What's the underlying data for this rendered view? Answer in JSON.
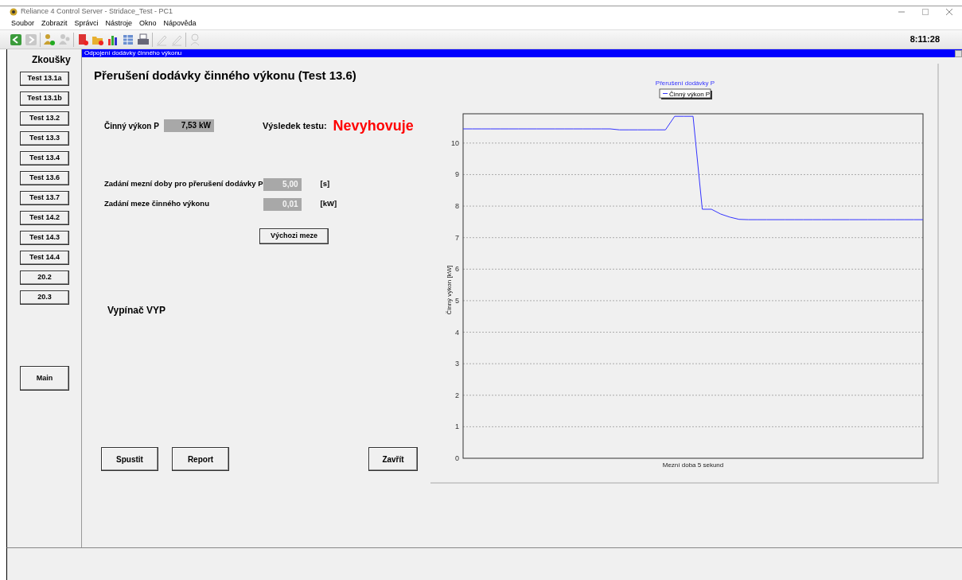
{
  "window": {
    "title": "Reliance 4 Control Server - Stridace_Test - PC1"
  },
  "menu": [
    {
      "label": "Soubor"
    },
    {
      "label": "Zobrazit"
    },
    {
      "label": "Správci"
    },
    {
      "label": "Nástroje"
    },
    {
      "label": "Okno"
    },
    {
      "label": "Nápověda"
    }
  ],
  "toolbar": {
    "buttons": [
      {
        "kind": "back",
        "disabled": false
      },
      {
        "kind": "forward",
        "disabled": true
      },
      {
        "kind": "user-add",
        "disabled": false
      },
      {
        "kind": "user",
        "disabled": true
      },
      {
        "kind": "document",
        "disabled": false
      },
      {
        "kind": "folder",
        "disabled": false
      },
      {
        "kind": "bar-chart",
        "disabled": false
      },
      {
        "kind": "table",
        "disabled": false
      },
      {
        "kind": "printer",
        "disabled": false
      },
      {
        "kind": "pen",
        "disabled": true
      },
      {
        "kind": "pen",
        "disabled": true
      },
      {
        "kind": "person",
        "disabled": true
      }
    ],
    "clock": "8:11:28"
  },
  "sidebar": {
    "heading": "Zkoušky",
    "buttons": [
      "Test 13.1a",
      "Test 13.1b",
      "Test 13.2",
      "Test 13.3",
      "Test 13.4",
      "Test 13.6",
      "Test 13.7",
      "Test 14.2",
      "Test 14.3",
      "Test 14.4",
      "20.2",
      "20.3"
    ],
    "main_button": "Main"
  },
  "dialog": {
    "title": "Odpojení dodávky činného výkonu",
    "heading": "Přerušení dodávky činného výkonu (Test 13.6)",
    "power": {
      "label": "Činný výkon P",
      "value": "7,53 kW"
    },
    "result": {
      "label": "Výsledek testu:",
      "value": "Nevyhovuje",
      "passed": false
    },
    "limits": [
      {
        "label": "Zadání mezní doby pro přerušení dodávky P",
        "value": "5,00",
        "unit": "[s]"
      },
      {
        "label": "Zadání meze činného výkonu",
        "value": "0,01",
        "unit": "[kW]"
      }
    ],
    "default_button": "Výchozi meze",
    "breaker_status": "Vypínač VYP",
    "buttons": [
      "Spustit",
      "Report"
    ],
    "close_button": "Zavřít",
    "chart": {
      "chart_data": {
        "type": "line",
        "title": "Přerušení dodávky P",
        "xlabel": "Mezní doba 5 sekund",
        "ylabel": "Činný výkon [kW]",
        "categories": [
          null,
          null,
          null,
          null,
          null,
          null,
          null,
          null,
          null,
          null,
          null,
          null,
          null,
          null,
          null,
          null,
          null,
          null,
          null,
          null,
          null,
          null,
          null,
          null,
          null,
          null,
          null,
          null,
          null,
          null,
          null,
          null,
          null,
          null,
          null,
          null,
          null,
          null,
          null,
          null,
          null,
          null,
          null,
          null,
          null,
          null,
          null,
          null,
          null,
          null,
          null
        ],
        "series": [
          {
            "name": "Činný výkon P",
            "color": "#3333ff",
            "values": [
              10.45,
              10.45,
              10.45,
              10.45,
              10.45,
              10.45,
              10.45,
              10.45,
              10.45,
              10.45,
              10.45,
              10.45,
              10.45,
              10.45,
              10.45,
              10.45,
              10.45,
              10.42,
              10.42,
              10.42,
              10.42,
              10.42,
              10.42,
              10.85,
              10.85,
              10.85,
              7.9,
              7.9,
              7.75,
              7.65,
              7.58,
              7.57,
              7.57,
              7.57,
              7.57,
              7.57,
              7.57,
              7.57,
              7.57,
              7.57,
              7.57,
              7.57,
              7.57,
              7.57,
              7.57,
              7.57,
              7.57,
              7.57,
              7.57,
              7.57,
              7.57
            ]
          }
        ],
        "ylim": [
          0,
          10.93
        ],
        "grid": true,
        "yticks": [
          0,
          1,
          2,
          3,
          4,
          5,
          6,
          7,
          8,
          9,
          10
        ]
      }
    }
  }
}
